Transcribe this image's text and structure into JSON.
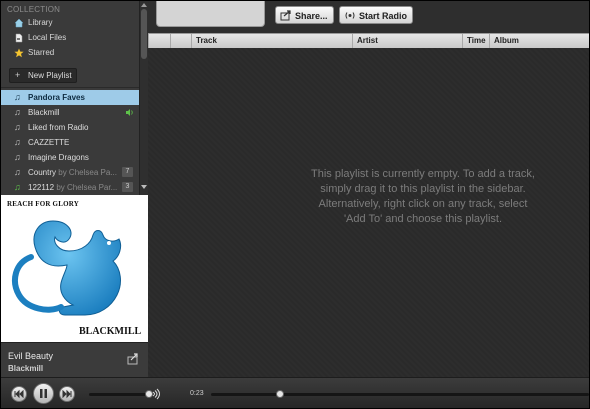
{
  "sidebar": {
    "collection_title": "COLLECTION",
    "collection_items": [
      {
        "label": "Library",
        "icon": "house-icon"
      },
      {
        "label": "Local Files",
        "icon": "file-icon"
      },
      {
        "label": "Starred",
        "icon": "star-icon"
      }
    ],
    "new_playlist_label": "New Playlist",
    "playlists": [
      {
        "label": "Pandora Faves",
        "by": "",
        "count": "",
        "active": true
      },
      {
        "label": "Blackmill",
        "by": "",
        "count": "",
        "playing": true
      },
      {
        "label": "Liked from Radio",
        "by": "",
        "count": ""
      },
      {
        "label": "CAZZETTE",
        "by": "",
        "count": ""
      },
      {
        "label": "Imagine Dragons",
        "by": "",
        "count": ""
      },
      {
        "label": "Country",
        "by": "by Chelsea Pa...",
        "count": "7"
      },
      {
        "label": "122112",
        "by": "by Chelsea Par...",
        "count": "3"
      }
    ]
  },
  "cover": {
    "title_text": "REACH FOR GLORY",
    "artist_text": "BLACKMILL"
  },
  "now_playing": {
    "track": "Evil Beauty",
    "artist": "Blackmill"
  },
  "toolbar": {
    "share_label": "Share...",
    "radio_label": "Start Radio"
  },
  "table": {
    "columns": [
      "Track",
      "Artist",
      "Time",
      "Album"
    ]
  },
  "empty_message": [
    "This playlist is currently empty. To add a track,",
    "simply drag it to this playlist in the sidebar.",
    "Alternatively, right click on any track, select",
    "'Add To' and choose this playlist."
  ],
  "player": {
    "elapsed": "0:23",
    "volume_fraction": 0.92,
    "progress_fraction": 0.17
  },
  "colors": {
    "active_playlist_bg": "#9ecbe8",
    "speaker_green": "#5ec24a",
    "squirrel_blue": "#2a9ad8"
  }
}
